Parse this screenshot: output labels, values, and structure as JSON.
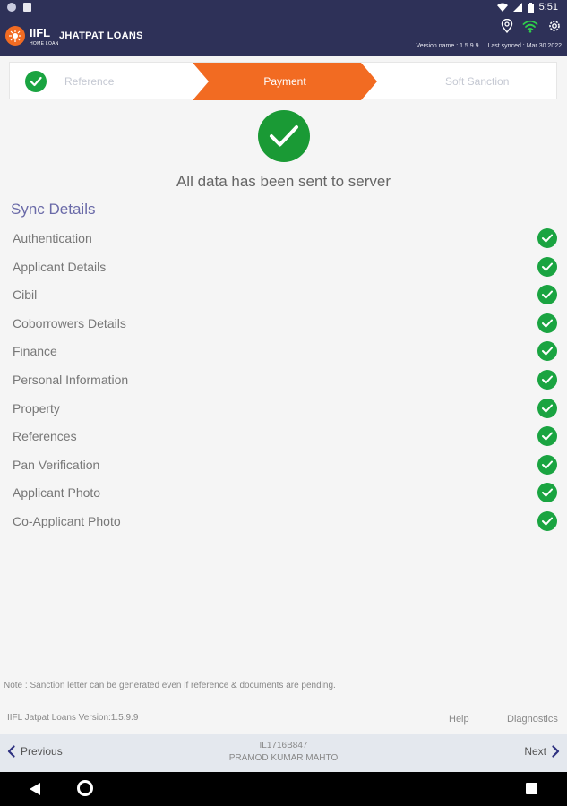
{
  "status_bar": {
    "time": "5:51"
  },
  "header": {
    "logo_text": "IIFL",
    "logo_sub": "HOME LOAN",
    "app_title": "JHATPAT LOANS",
    "version_label": "Version name : 1.5.9.9",
    "last_synced": "Last synced : Mar 30 2022"
  },
  "stepper": {
    "steps": [
      {
        "label": "Reference",
        "state": "done"
      },
      {
        "label": "Payment",
        "state": "active"
      },
      {
        "label": "Soft Sanction",
        "state": "pending"
      }
    ],
    "active_color": "#f26b22",
    "done_color": "#1aa441"
  },
  "success": {
    "message": "All data has been sent to server"
  },
  "sync": {
    "title": "Sync Details",
    "items": [
      {
        "label": "Authentication",
        "status": "synced"
      },
      {
        "label": "Applicant Details",
        "status": "synced"
      },
      {
        "label": "Cibil",
        "status": "synced"
      },
      {
        "label": "Coborrowers Details",
        "status": "synced"
      },
      {
        "label": "Finance",
        "status": "synced"
      },
      {
        "label": "Personal Information",
        "status": "synced"
      },
      {
        "label": "Property",
        "status": "synced"
      },
      {
        "label": "References",
        "status": "synced"
      },
      {
        "label": "Pan Verification",
        "status": "synced"
      },
      {
        "label": "Applicant Photo",
        "status": "synced"
      },
      {
        "label": "Co-Applicant Photo",
        "status": "synced"
      }
    ]
  },
  "note": "Note : Sanction letter can be generated even if reference & documents are pending.",
  "footer": {
    "version": "IIFL Jatpat Loans  Version:1.5.9.9",
    "help": "Help",
    "diagnostics": "Diagnostics"
  },
  "bottom_nav": {
    "previous": "Previous",
    "next": "Next",
    "loan_id": "IL1716B847",
    "customer_name": "PRAMOD KUMAR MAHTO"
  },
  "colors": {
    "header_bg": "#2e3158",
    "accent_orange": "#f26b22",
    "success_green": "#1aa441",
    "title_purple": "#6a6aa8"
  }
}
